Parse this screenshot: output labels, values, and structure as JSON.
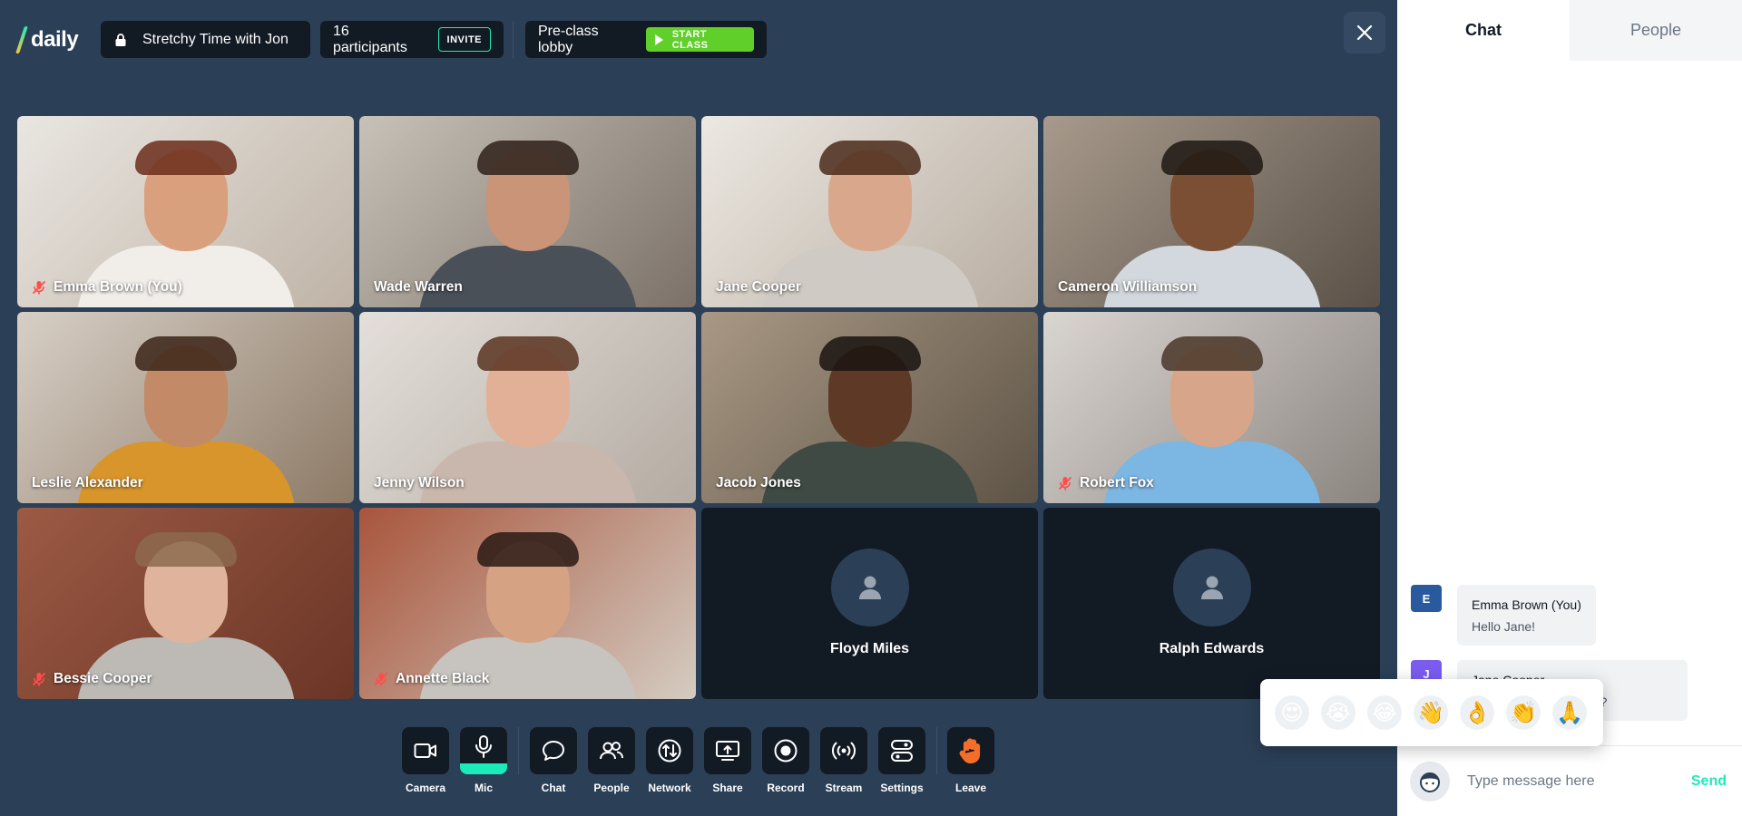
{
  "app": {
    "logo_text": "daily"
  },
  "header": {
    "room_title": "Stretchy Time with Jon",
    "participant_count": "16 participants",
    "invite_label": "INVITE",
    "lobby_label": "Pre-class lobby",
    "start_class_label": "START CLASS"
  },
  "grid": {
    "tiles": [
      {
        "name": "Emma Brown (You)",
        "muted": true,
        "bg": [
          "#e9e6e1",
          "#bfb3a6"
        ],
        "skin": "#d9a07e",
        "hair": "#6b2c1a",
        "shirt": "#f1ede8"
      },
      {
        "name": "Wade Warren",
        "muted": false,
        "bg": [
          "#c7c1b7",
          "#7b7168"
        ],
        "skin": "#c99478",
        "hair": "#2e211a",
        "shirt": "#4a5058"
      },
      {
        "name": "Jane Cooper",
        "muted": false,
        "bg": [
          "#ece8e2",
          "#b8ada1"
        ],
        "skin": "#d9a88c",
        "hair": "#4a2a1a",
        "shirt": "#cfcac3"
      },
      {
        "name": "Cameron Williamson",
        "muted": false,
        "bg": [
          "#a79a8c",
          "#5b5148"
        ],
        "skin": "#7a4f34",
        "hair": "#1f1713",
        "shirt": "#d2d8de"
      },
      {
        "name": "Leslie Alexander",
        "muted": false,
        "bg": [
          "#d7cfc6",
          "#8d7a66"
        ],
        "skin": "#c28a66",
        "hair": "#3b2418",
        "shirt": "#d7952b"
      },
      {
        "name": "Jenny Wilson",
        "muted": false,
        "bg": [
          "#e3dfda",
          "#b4aba2"
        ],
        "skin": "#e1b096",
        "hair": "#5a3422",
        "shirt": "#c9b7ad"
      },
      {
        "name": "Jacob Jones",
        "muted": false,
        "bg": [
          "#a99884",
          "#5d5346"
        ],
        "skin": "#5e3a26",
        "hair": "#1a1410",
        "shirt": "#3f4a44"
      },
      {
        "name": "Robert Fox",
        "muted": true,
        "bg": [
          "#d9d5d1",
          "#8b8580"
        ],
        "skin": "#d7a68a",
        "hair": "#4a3628",
        "shirt": "#7cb6e2"
      },
      {
        "name": "Bessie Cooper",
        "muted": true,
        "bg": [
          "#9b5a44",
          "#6b3526"
        ],
        "skin": "#e0b49c",
        "hair": "#8c6a4e",
        "shirt": "#bdbab6"
      },
      {
        "name": "Annette Black",
        "muted": true,
        "bg": [
          "#a8553c",
          "#d4ccc2"
        ],
        "skin": "#d6a284",
        "hair": "#2a1a14",
        "shirt": "#c7c3be"
      }
    ],
    "empty_tiles": [
      {
        "name": "Floyd Miles"
      },
      {
        "name": "Ralph Edwards"
      }
    ]
  },
  "tray": {
    "camera_label": "Camera",
    "mic_label": "Mic",
    "chat_label": "Chat",
    "people_label": "People",
    "network_label": "Network",
    "share_label": "Share",
    "record_label": "Record",
    "stream_label": "Stream",
    "settings_label": "Settings",
    "leave_label": "Leave"
  },
  "emoji_reactions": [
    "😍",
    "😭",
    "😂",
    "👋",
    "👌",
    "👏",
    "🙏"
  ],
  "panel": {
    "tab_chat": "Chat",
    "tab_people": "People",
    "messages": [
      {
        "initial": "E",
        "author": "Emma Brown (You)",
        "text": "Hello Jane!",
        "color": "#2a5a9e"
      },
      {
        "initial": "J",
        "author": "Jane Cooper",
        "text": "Hi Emma, how are you?",
        "color": "#7b5cf0"
      }
    ],
    "composer_placeholder": "Type message here",
    "send_label": "Send"
  },
  "colors": {
    "accent": "#1bebb9",
    "start_green": "#60cf2a",
    "background": "#2b3f56",
    "surface_dark": "#121a24"
  }
}
